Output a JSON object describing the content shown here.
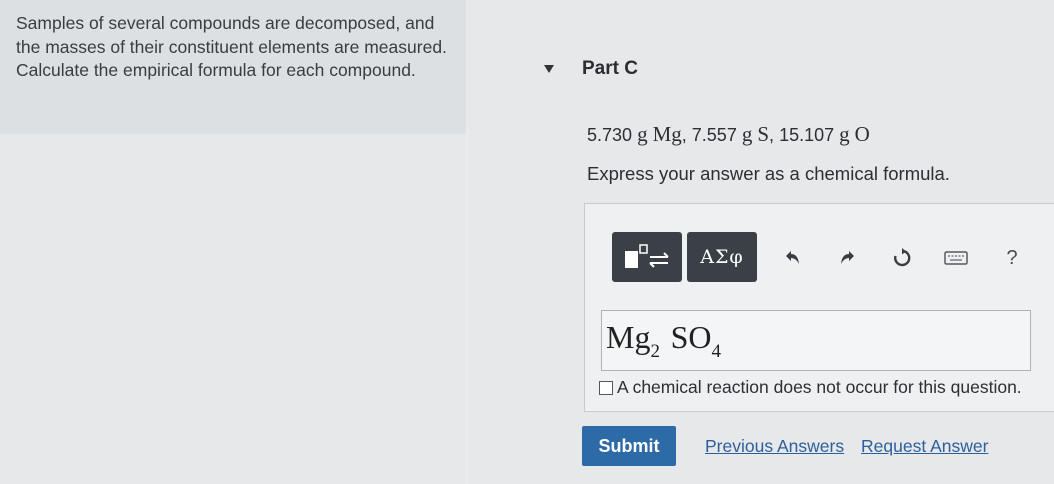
{
  "problem": {
    "intro_text": "Samples of several compounds are decomposed, and the masses of their constituent elements are measured. Calculate the empirical formula for each compound."
  },
  "part": {
    "title": "Part C",
    "given": {
      "m1": "5.730",
      "u1": "g",
      "e1": "Mg",
      "m2": "7.557",
      "u2": "g",
      "e2": "S",
      "m3": "15.107",
      "u3": "g",
      "e3": "O"
    },
    "instructions": "Express your answer as a chemical formula."
  },
  "toolbar": {
    "template_icon": "template-icon",
    "greek_label": "ΑΣφ",
    "undo_icon": "undo-icon",
    "redo_icon": "redo-icon",
    "reset_icon": "reset-icon",
    "keyboard_icon": "keyboard-icon",
    "help_label": "?"
  },
  "answer": {
    "el1": "Mg",
    "sub1": "2",
    "el2": "SO",
    "sub2": "4"
  },
  "no_reaction": {
    "checked": false,
    "label": "A chemical reaction does not occur for this question."
  },
  "actions": {
    "submit": "Submit",
    "previous_answers": "Previous Answers",
    "request_answer": "Request Answer"
  },
  "colors": {
    "submit_bg": "#2d6aa8",
    "toolbar_bg": "#3b4047",
    "link": "#2d5f9c"
  }
}
